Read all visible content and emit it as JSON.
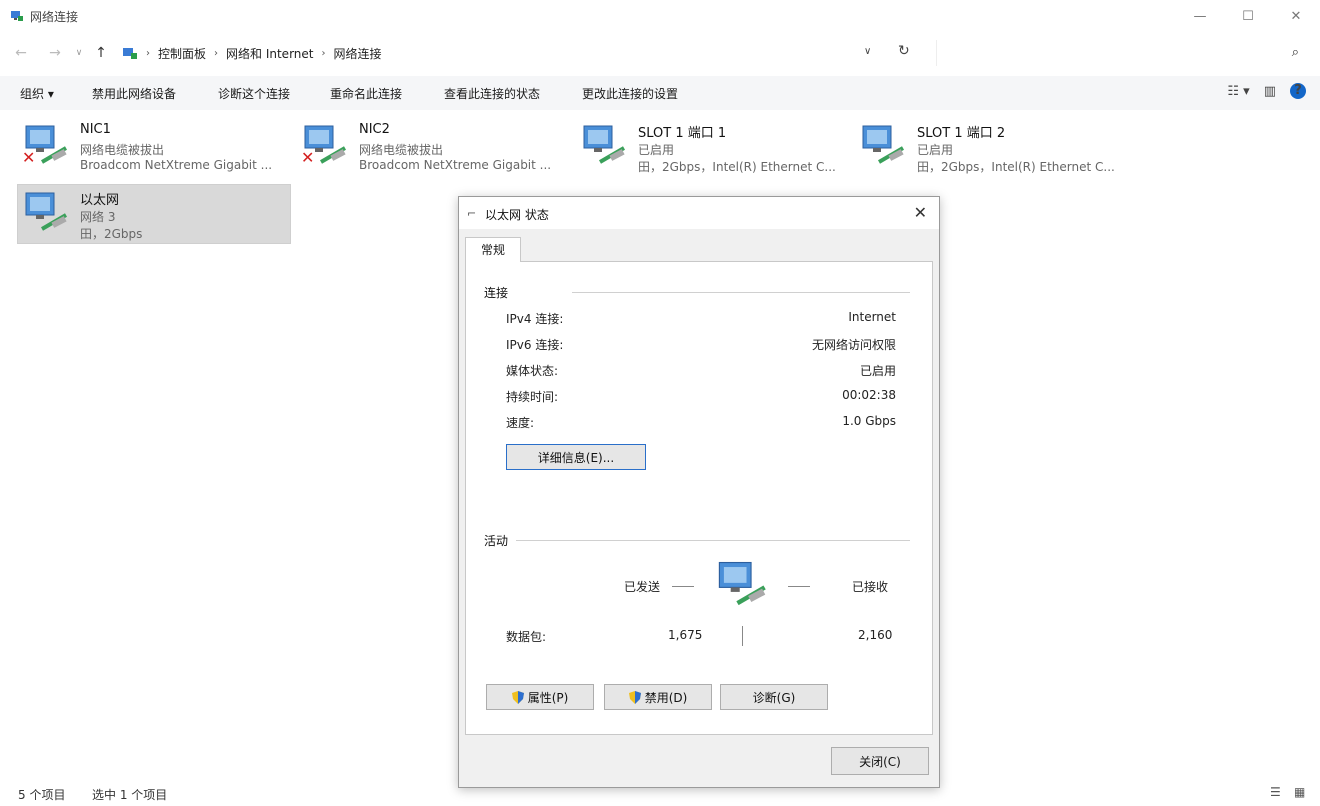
{
  "window": {
    "title": "网络连接"
  },
  "address": {
    "crumbs": [
      "控制面板",
      "网络和 Internet",
      "网络连接"
    ]
  },
  "search": {
    "placeholder": ""
  },
  "commands": {
    "organize": "组织 ▾",
    "disable": "禁用此网络设备",
    "diagnose": "诊断这个连接",
    "rename": "重命名此连接",
    "view_status": "查看此连接的状态",
    "change_settings": "更改此连接的设置"
  },
  "connections": [
    {
      "name": "NIC1",
      "status": "网络电缆被拔出",
      "device": "Broadcom NetXtreme Gigabit ...",
      "disconnected": true
    },
    {
      "name": "NIC2",
      "status": "网络电缆被拔出",
      "device": "Broadcom NetXtreme Gigabit ...",
      "disconnected": true
    },
    {
      "name": "SLOT 1 端口 1",
      "status": "已启用",
      "device": "田，2Gbps，Intel(R) Ethernet C...",
      "disconnected": false
    },
    {
      "name": "SLOT 1 端口 2",
      "status": "已启用",
      "device": "田，2Gbps，Intel(R) Ethernet C...",
      "disconnected": false
    },
    {
      "name": "以太网",
      "status": "网络 3",
      "device": "田，2Gbps",
      "disconnected": false,
      "selected": true
    }
  ],
  "statusbar": {
    "count": "5 个项目",
    "selected": "选中 1 个项目"
  },
  "dialog": {
    "title": "以太网 状态",
    "tab": "常规",
    "connection_group": "连接",
    "rows": [
      {
        "label": "IPv4 连接:",
        "value": "Internet"
      },
      {
        "label": "IPv6 连接:",
        "value": "无网络访问权限"
      },
      {
        "label": "媒体状态:",
        "value": "已启用"
      },
      {
        "label": "持续时间:",
        "value": "00:02:38"
      },
      {
        "label": "速度:",
        "value": "1.0 Gbps"
      }
    ],
    "details_button": "详细信息(E)...",
    "activity_group": "活动",
    "sent_label": "已发送",
    "received_label": "已接收",
    "packets_label": "数据包:",
    "packets_sent": "1,675",
    "packets_received": "2,160",
    "properties_button": "属性(P)",
    "disable_button": "禁用(D)",
    "diagnose_button": "诊断(G)",
    "close_button": "关闭(C)"
  }
}
